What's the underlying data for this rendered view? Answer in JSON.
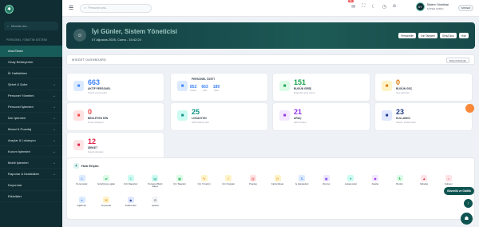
{
  "sidebar": {
    "brand": "",
    "search_placeholder": "Menüde ara...",
    "section": "PERSONEL YÖNETİM SİSTEMİ",
    "items": [
      {
        "label": "Ana Ekran",
        "arrow": ""
      },
      {
        "label": "Onay Bekleyenler",
        "arrow": ""
      },
      {
        "label": "İK Haftalıkları",
        "arrow": ""
      },
      {
        "label": "Şirket & Şube",
        "arrow": "→"
      },
      {
        "label": "Personel Yönetimi",
        "arrow": "→"
      },
      {
        "label": "Personel İşlemleri",
        "arrow": "→"
      },
      {
        "label": "İzin İşlemleri",
        "arrow": "→"
      },
      {
        "label": "Mesai & Puantaj",
        "arrow": "→"
      },
      {
        "label": "Araçlar & Lokasyon",
        "arrow": "→"
      },
      {
        "label": "Kurum İşlemleri",
        "arrow": "→"
      },
      {
        "label": "Mobil İşlemleri",
        "arrow": "→"
      },
      {
        "label": "Raporlar & İstatistikler",
        "arrow": "→"
      },
      {
        "label": "Duyurular",
        "arrow": ""
      },
      {
        "label": "Etkinlikler",
        "arrow": ""
      }
    ]
  },
  "topbar": {
    "search_placeholder": "Personel ara...",
    "badge": "99+",
    "user_name": "Sistem Yöneticisi",
    "user_role": "SÜPER ADMİN",
    "user_initials": "SY",
    "system_label": "SİSTEM"
  },
  "hero": {
    "title": "İyi Günler, Sistem Yöneticisi",
    "date": "07 Ağustos 2026, Cuma - 15:42:24",
    "buttons": [
      "Personeller",
      "İzin Talepleri",
      "Giriş/Çıkış",
      "Hızlı"
    ]
  },
  "widget": {
    "title": "WİDGET DASHBOARD",
    "button": "Düzeni Düzenle"
  },
  "cards": [
    {
      "value": "663",
      "label": "AKTİF PERSONEL",
      "sub": "Kayıtlı personeller",
      "color": "#3b82f6",
      "bg": "#dbeafe",
      "icon": "users-icon"
    },
    {
      "value": "",
      "label": "PERSONEL ÖZETİ",
      "sub": "",
      "color": "#3b82f6",
      "bg": "#dbeafe",
      "icon": "chart-icon",
      "trio": [
        {
          "n": "852",
          "s": "Toplam"
        },
        {
          "n": "663",
          "s": "Aktif"
        },
        {
          "n": "189",
          "s": "Pasif"
        }
      ]
    },
    {
      "value": "151",
      "label": "BUGÜN GİRİŞ",
      "sub": "Bugünkü giriş sayısı",
      "color": "#16a34a",
      "bg": "#dcfce7",
      "icon": "login-icon"
    },
    {
      "value": "0",
      "label": "BUGÜN GEÇ",
      "sub": "Geç gelenler",
      "color": "#d97706",
      "bg": "#fef3c7",
      "icon": "clock-icon"
    },
    {
      "value": "0",
      "label": "BEKLEYEN İZİN",
      "sub": "Onay bekleyen",
      "color": "#ef4444",
      "bg": "#fee2e2",
      "icon": "calendar-icon"
    },
    {
      "value": "25",
      "label": "LOKASYON",
      "sub": "Aktif lokasyonlar",
      "color": "#0d9488",
      "bg": "#ccfbf1",
      "icon": "location-icon"
    },
    {
      "value": "21",
      "label": "ARAÇ",
      "sub": "Aktif araçlar",
      "color": "#9333ea",
      "bg": "#f3e8ff",
      "icon": "car-icon"
    },
    {
      "value": "23",
      "label": "KULLANICI",
      "sub": "Sistem kullanıcıları",
      "color": "#1e3a8a",
      "bg": "#e0e7ff",
      "icon": "user-icon"
    },
    {
      "value": "12",
      "label": "ŞİRKET",
      "sub": "Kayıtlı şirketler",
      "color": "#e11d48",
      "bg": "#ffe4e6",
      "icon": "building-icon"
    }
  ],
  "quick": {
    "title": "Hızlı Erişim",
    "items": [
      {
        "l": "Personeller",
        "c": "#3b82f6",
        "bg": "#dbeafe",
        "g": "☺"
      },
      {
        "l": "Giriş/Çıkış Logları",
        "c": "#16a34a",
        "bg": "#dcfce7",
        "g": "⇄"
      },
      {
        "l": "G/Ç Raporları",
        "c": "#0d9488",
        "bg": "#ccfbf1",
        "g": "≡"
      },
      {
        "l": "Personel Bazlı Rapor",
        "c": "#0d9488",
        "bg": "#ccfbf1",
        "g": "▤"
      },
      {
        "l": "İzin Talepleri",
        "c": "#16a34a",
        "bg": "#dcfce7",
        "g": "▦"
      },
      {
        "l": "İzin Yönetimi",
        "c": "#d97706",
        "bg": "#fef3c7",
        "g": "✎"
      },
      {
        "l": "İzin Onayları",
        "c": "#d97706",
        "bg": "#fef3c7",
        "g": "✓"
      },
      {
        "l": "Puantaj",
        "c": "#ef4444",
        "bg": "#fee2e2",
        "g": "▥"
      },
      {
        "l": "Fazla Mesai",
        "c": "#d97706",
        "bg": "#fef3c7",
        "g": "◷"
      },
      {
        "l": "İş Hareketleri",
        "c": "#3b82f6",
        "bg": "#dbeafe",
        "g": "⇅"
      },
      {
        "l": "Zimmet",
        "c": "#7c3aed",
        "bg": "#ede9fe",
        "g": "▣"
      },
      {
        "l": "Lokasyonlar",
        "c": "#0d9488",
        "bg": "#ccfbf1",
        "g": "⌖"
      },
      {
        "l": "Araçlar",
        "c": "#9333ea",
        "bg": "#f3e8ff",
        "g": "◆"
      },
      {
        "l": "Bordro",
        "c": "#16a34a",
        "bg": "#dcfce7",
        "g": "₺"
      },
      {
        "l": "Şirketler",
        "c": "#e11d48",
        "bg": "#ffe4e6",
        "g": "▲"
      },
      {
        "l": "Şubeler",
        "c": "#e11d48",
        "bg": "#ffe4e6",
        "g": "⌂"
      },
      {
        "l": "Eğitimler",
        "c": "#3b82f6",
        "bg": "#dbeafe",
        "g": "✦"
      },
      {
        "l": "Duyurular",
        "c": "#d97706",
        "bg": "#fef3c7",
        "g": "✉"
      },
      {
        "l": "Kullanıcılar",
        "c": "#1e3a8a",
        "bg": "#e0e7ff",
        "g": "☻"
      },
      {
        "l": "Ayarlar",
        "c": "#6b7280",
        "bg": "#f3f4f6",
        "g": "⚙"
      }
    ]
  },
  "secure_label": "Güvenlik ve Gizlilik"
}
